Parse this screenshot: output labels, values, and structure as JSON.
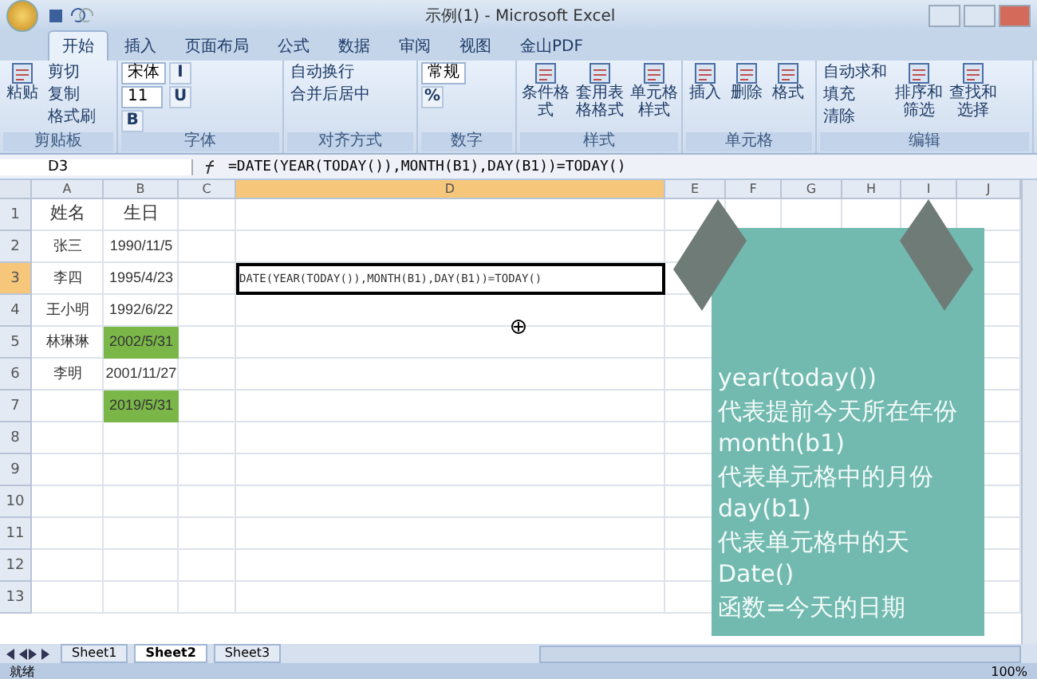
{
  "window": {
    "title": "示例(1) - Microsoft Excel"
  },
  "ribbon_tabs": [
    {
      "label": "开始",
      "selected": true
    },
    {
      "label": "插入",
      "selected": false
    },
    {
      "label": "页面布局",
      "selected": false
    },
    {
      "label": "公式",
      "selected": false
    },
    {
      "label": "数据",
      "selected": false
    },
    {
      "label": "审阅",
      "selected": false
    },
    {
      "label": "视图",
      "selected": false
    },
    {
      "label": "金山PDF",
      "selected": false
    }
  ],
  "ribbon_groups": [
    {
      "label": "剪贴板",
      "items": [
        {
          "kind": "large",
          "label": "粘贴"
        },
        {
          "kind": "small",
          "label": "剪切"
        },
        {
          "kind": "small",
          "label": "复制"
        },
        {
          "kind": "small",
          "label": "格式刷"
        }
      ]
    },
    {
      "label": "字体",
      "items": [
        {
          "kind": "field",
          "value": "宋体"
        },
        {
          "kind": "field",
          "value": "11"
        },
        {
          "kind": "letter",
          "label": "B"
        },
        {
          "kind": "letter",
          "label": "I"
        },
        {
          "kind": "letter",
          "label": "U"
        }
      ]
    },
    {
      "label": "对齐方式",
      "items": [
        {
          "kind": "small",
          "label": "自动换行"
        },
        {
          "kind": "small",
          "label": "合并后居中"
        }
      ]
    },
    {
      "label": "数字",
      "items": [
        {
          "kind": "field",
          "value": "常规"
        },
        {
          "kind": "letter",
          "label": "%"
        }
      ]
    },
    {
      "label": "样式",
      "items": [
        {
          "kind": "large",
          "label": "条件格式"
        },
        {
          "kind": "large",
          "label": "套用表格格式"
        },
        {
          "kind": "large",
          "label": "单元格样式"
        }
      ]
    },
    {
      "label": "单元格",
      "items": [
        {
          "kind": "large",
          "label": "插入"
        },
        {
          "kind": "large",
          "label": "删除"
        },
        {
          "kind": "large",
          "label": "格式"
        }
      ]
    },
    {
      "label": "编辑",
      "items": [
        {
          "kind": "small",
          "label": "自动求和"
        },
        {
          "kind": "small",
          "label": "填充"
        },
        {
          "kind": "small",
          "label": "清除"
        },
        {
          "kind": "large",
          "label": "排序和筛选"
        },
        {
          "kind": "large",
          "label": "查找和选择"
        }
      ]
    }
  ],
  "formula_bar": {
    "name_box": "D3",
    "formula": "=DATE(YEAR(TODAY()),MONTH(B1),DAY(B1))=TODAY()"
  },
  "columns": [
    {
      "label": "A",
      "selected": false
    },
    {
      "label": "B",
      "selected": false
    },
    {
      "label": "C",
      "selected": false
    },
    {
      "label": "D",
      "selected": true
    },
    {
      "label": "E",
      "selected": false
    },
    {
      "label": "F",
      "selected": false
    },
    {
      "label": "G",
      "selected": false
    },
    {
      "label": "H",
      "selected": false
    },
    {
      "label": "I",
      "selected": false
    },
    {
      "label": "J",
      "selected": false
    }
  ],
  "rows": [
    {
      "number": "1",
      "selected": false,
      "name": "姓名",
      "birthday": {
        "text": "生日",
        "highlighted": false
      }
    },
    {
      "number": "2",
      "selected": false,
      "name": "张三",
      "birthday": {
        "text": "1990/11/5",
        "highlighted": false
      }
    },
    {
      "number": "3",
      "selected": true,
      "name": "李四",
      "birthday": {
        "text": "1995/4/23",
        "highlighted": false
      },
      "column_d": "DATE(YEAR(TODAY()),MONTH(B1),DAY(B1))=TODAY()"
    },
    {
      "number": "4",
      "selected": false,
      "name": "王小明",
      "birthday": {
        "text": "1992/6/22",
        "highlighted": false
      }
    },
    {
      "number": "5",
      "selected": false,
      "name": "林琳琳",
      "birthday": {
        "text": "2002/5/31",
        "highlighted": true
      }
    },
    {
      "number": "6",
      "selected": false,
      "name": "李明",
      "birthday": {
        "text": "2001/11/27",
        "highlighted": false
      }
    },
    {
      "number": "7",
      "selected": false,
      "birthday": {
        "text": "2019/5/31",
        "highlighted": true
      }
    },
    {
      "number": "8",
      "selected": false
    },
    {
      "number": "9",
      "selected": false
    },
    {
      "number": "10",
      "selected": false
    },
    {
      "number": "11",
      "selected": false
    },
    {
      "number": "12",
      "selected": false
    },
    {
      "number": "13",
      "selected": false
    }
  ],
  "note": {
    "lines": [
      "year(today())",
      "代表提前今天所在年份",
      "month(b1)",
      "代表单元格中的月份",
      "day(b1)",
      "代表单元格中的天",
      "Date()",
      "函数=今天的日期"
    ]
  },
  "sheet_tabs": [
    {
      "label": "Sheet1",
      "selected": false
    },
    {
      "label": "Sheet2",
      "selected": true
    },
    {
      "label": "Sheet3",
      "selected": false
    }
  ],
  "status_bar": {
    "status": "就绪",
    "zoom": "100%"
  }
}
